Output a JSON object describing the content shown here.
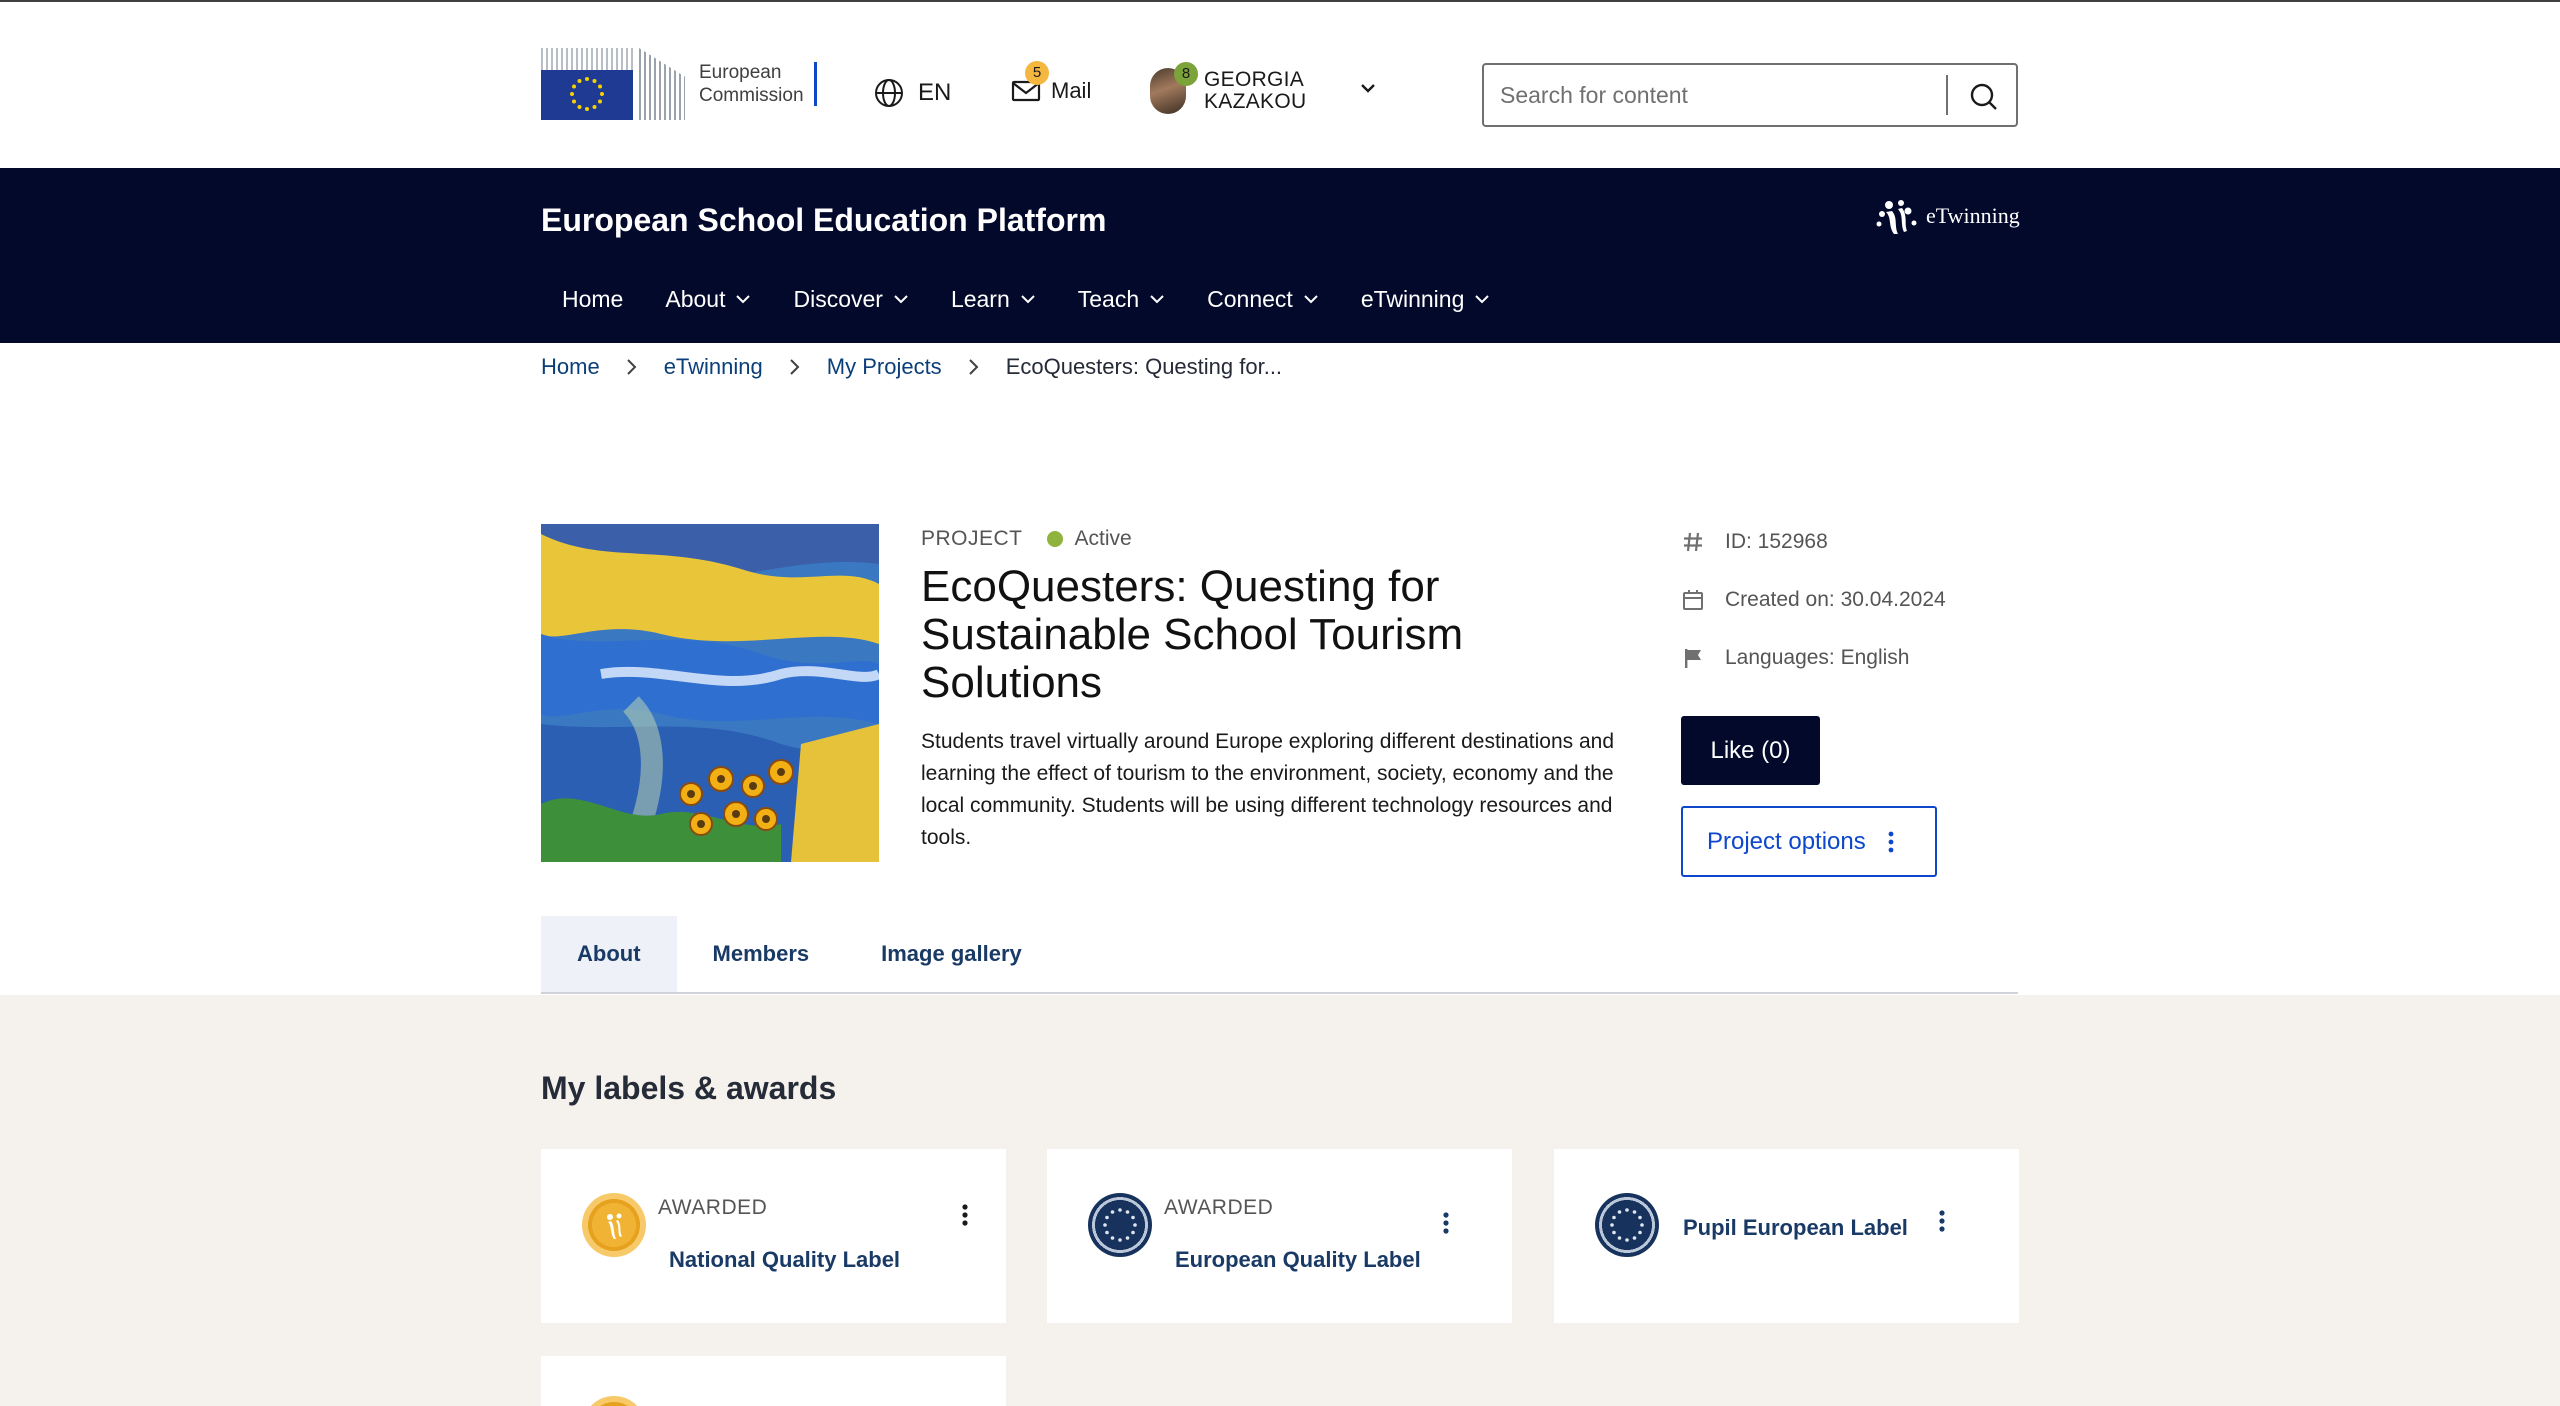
{
  "header": {
    "logo_text_line1": "European",
    "logo_text_line2": "Commission",
    "language": "EN",
    "mail_label": "Mail",
    "mail_count": "5",
    "notif_count": "8",
    "user_first": "GEORGIA",
    "user_last": "KAZAKOU",
    "search_placeholder": "Search for content"
  },
  "band": {
    "site_title": "European School Education Platform",
    "partner_logo": "eTwinning",
    "nav": [
      "Home",
      "About",
      "Discover",
      "Learn",
      "Teach",
      "Connect",
      "eTwinning"
    ]
  },
  "breadcrumb": [
    "Home",
    "eTwinning",
    "My Projects",
    "EcoQuesters: Questing for..."
  ],
  "project": {
    "kicker": "PROJECT",
    "status": "Active",
    "title": "EcoQuesters: Questing for Sustainable School Tourism Solutions",
    "description": "Students travel virtually around Europe exploring different destinations and learning the effect of tourism to the environment, society, economy and the local community. Students will be using different technology resources and tools.",
    "id": "ID: 152968",
    "created": "Created on: 30.04.2024",
    "languages": "Languages: English",
    "like_label": "Like (0)",
    "options_label": "Project options"
  },
  "tabs": [
    "About",
    "Members",
    "Image gallery"
  ],
  "awards": {
    "title": "My labels & awards",
    "cards": [
      {
        "kicker": "AWARDED",
        "label": "National Quality Label"
      },
      {
        "kicker": "AWARDED",
        "label": "European Quality Label"
      },
      {
        "kicker": "",
        "label": "Pupil European Label"
      }
    ]
  },
  "colors": {
    "navy": "#03092b",
    "link": "#0e47cb",
    "status_active": "#8fb33d",
    "beige": "#f5f1ed"
  }
}
